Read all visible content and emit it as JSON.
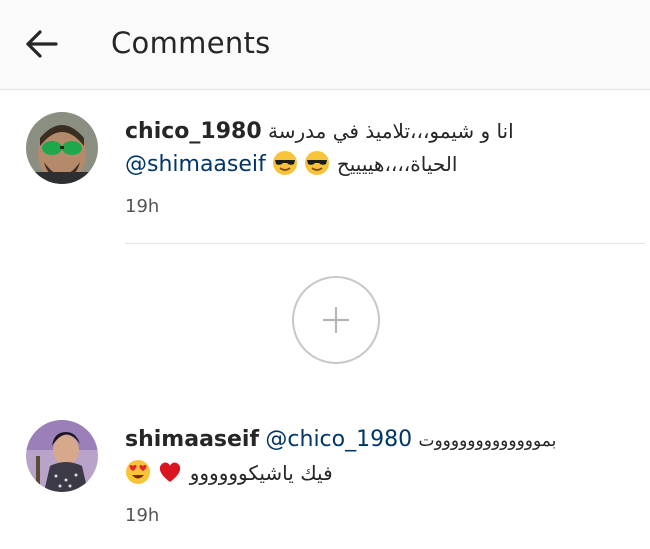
{
  "header": {
    "title": "Comments"
  },
  "comments": [
    {
      "username": "chico_1980",
      "text_line1": "انا و شيمو،،،تلاميذ في مدرسة",
      "mention": "@shimaaseif",
      "text_line2": "الحياة،،،،هييييح",
      "emojis_line2": [
        "sunglasses-emoji",
        "sunglasses-emoji"
      ],
      "time": "19h"
    },
    {
      "username": "shimaaseif",
      "mention": "@chico_1980",
      "text_line1": "بموووووووووووووت",
      "text_line2": "فيك ياشيكوووووو",
      "emojis_line2": [
        "heart-eyes-emoji",
        "red-heart-emoji"
      ],
      "time": "19h"
    }
  ],
  "load_more": {
    "icon": "plus-icon"
  }
}
